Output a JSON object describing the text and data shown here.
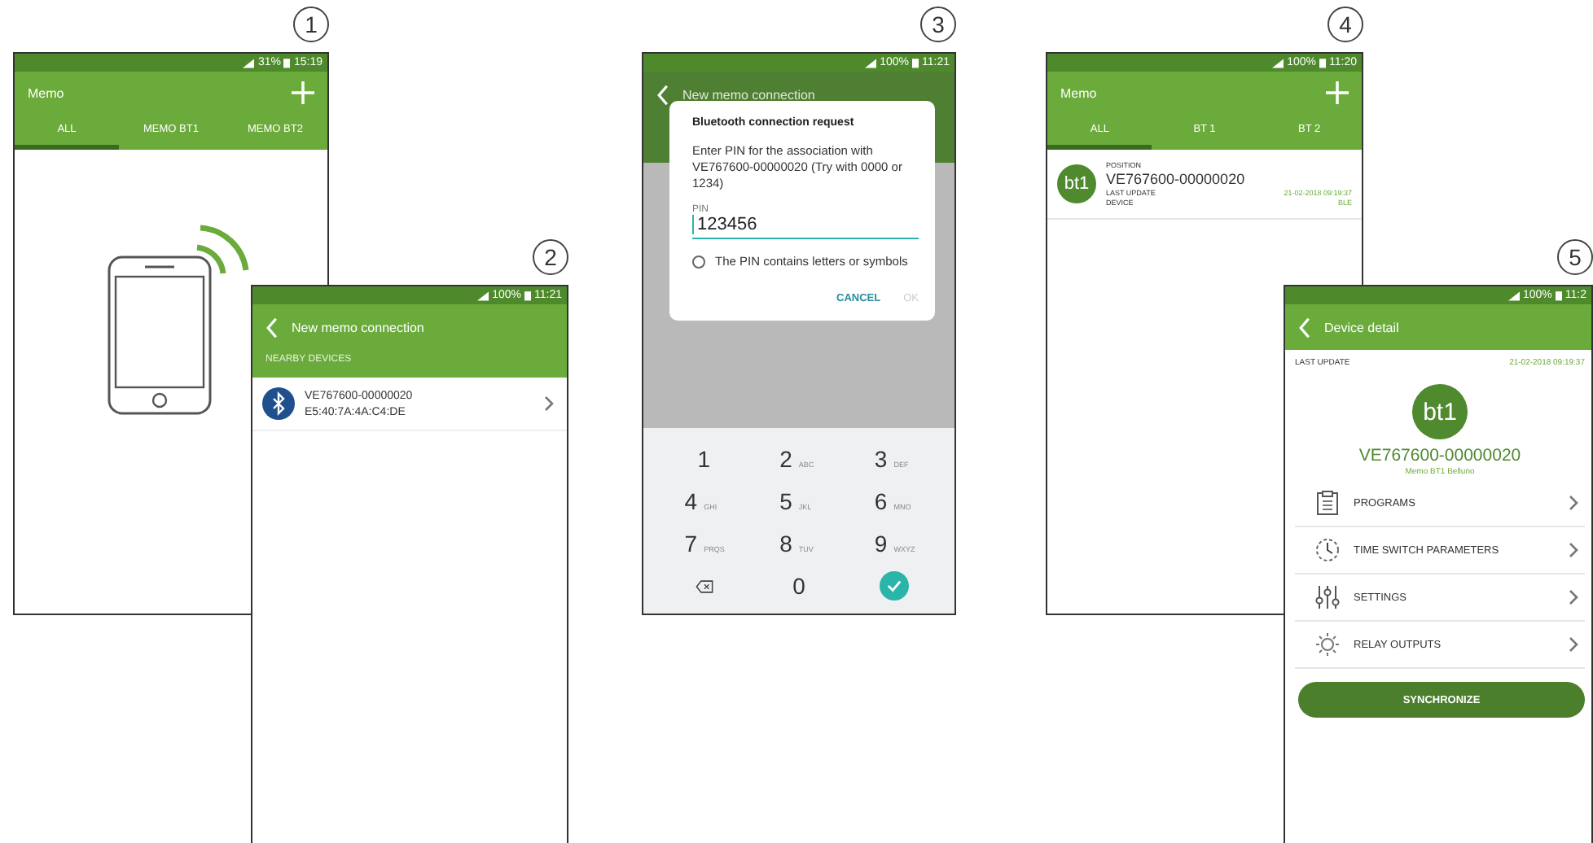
{
  "screens": [
    {
      "kind": "memo",
      "number": "1",
      "status": {
        "battery": "31%",
        "time": "15:19"
      },
      "title": "Memo",
      "tabs": [
        {
          "label": "ALL",
          "selected": true
        },
        {
          "label": "MEMO BT1",
          "selected": false
        },
        {
          "label": "MEMO BT2",
          "selected": false
        }
      ]
    },
    {
      "kind": "connection",
      "number": "2",
      "status": {
        "battery": "100%",
        "time": "11:21"
      },
      "title": "New memo connection",
      "section": "NEARBY DEVICES",
      "devices": [
        {
          "name": "VE767600-00000020",
          "address": "E5:40:7A:4A:C4:DE"
        }
      ]
    },
    {
      "kind": "pin_dialog",
      "number": "3",
      "status": {
        "battery": "100%",
        "time": "11:21"
      },
      "title": "New memo connection",
      "dialog": {
        "title": "Bluetooth connection request",
        "message": "Enter PIN for the association with VE767600-00000020 (Try with 0000 or 1234)",
        "field_label": "PIN",
        "value": "123456",
        "option": {
          "label": "The PIN contains letters or symbols",
          "checked": false
        },
        "buttons": [
          {
            "label": "CANCEL",
            "disabled": false
          },
          {
            "label": "OK",
            "disabled": true
          }
        ]
      },
      "keys": [
        {
          "kind": "digit",
          "digit": "1"
        },
        {
          "kind": "digit",
          "digit": "2",
          "letters": "ABC"
        },
        {
          "kind": "digit",
          "digit": "3",
          "letters": "DEF"
        },
        {
          "kind": "digit",
          "digit": "4",
          "letters": "GHI"
        },
        {
          "kind": "digit",
          "digit": "5",
          "letters": "JKL"
        },
        {
          "kind": "digit",
          "digit": "6",
          "letters": "MNO"
        },
        {
          "kind": "digit",
          "digit": "7",
          "letters": "PRQS"
        },
        {
          "kind": "digit",
          "digit": "8",
          "letters": "TUV"
        },
        {
          "kind": "digit",
          "digit": "9",
          "letters": "WXYZ"
        },
        {
          "kind": "backspace"
        },
        {
          "kind": "digit",
          "digit": "0"
        },
        {
          "kind": "done"
        }
      ]
    },
    {
      "kind": "memo",
      "number": "4",
      "status": {
        "battery": "100%",
        "time": "11:20"
      },
      "title": "Memo",
      "tabs": [
        {
          "label": "ALL",
          "selected": true
        },
        {
          "label": "BT 1",
          "selected": false
        },
        {
          "label": "BT 2",
          "selected": false
        }
      ],
      "devices": [
        {
          "badge": "bt1",
          "position_label": "POSITION",
          "name": "VE767600-00000020",
          "update_label": "LAST UPDATE",
          "update": "21-02-2018 09:19:37",
          "device_label": "DEVICE",
          "device": "BLE"
        }
      ]
    },
    {
      "kind": "detail",
      "number": "5",
      "status": {
        "battery": "100%",
        "time": "11:2"
      },
      "title": "Device detail",
      "update_label": "LAST UPDATE",
      "update": "21-02-2018 09:19:37",
      "badge": "bt1",
      "name": "VE767600-00000020",
      "subtitle": "Memo BT1 Belluno",
      "menu": [
        {
          "kind": "clipboard",
          "label": "PROGRAMS"
        },
        {
          "kind": "clock",
          "label": "TIME SWITCH PARAMETERS"
        },
        {
          "kind": "sliders",
          "label": "SETTINGS"
        },
        {
          "kind": "sun",
          "label": "RELAY OUTPUTS"
        }
      ],
      "button": "SYNCHRONIZE"
    }
  ]
}
